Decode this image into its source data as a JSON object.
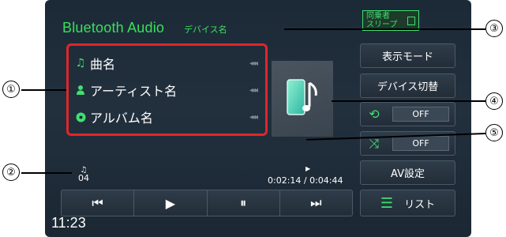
{
  "header": {
    "title": "Bluetooth Audio",
    "device_name": "デバイス名",
    "passenger_label_1": "同乗者",
    "passenger_label_2": "スリープ"
  },
  "track_info": {
    "title": "曲名",
    "artist": "アーティスト名",
    "album": "アルバム名"
  },
  "side_buttons": {
    "display_mode": "表示モード",
    "device_switch": "デバイス切替",
    "repeat_value": "OFF",
    "shuffle_value": "OFF",
    "av_settings": "AV設定",
    "list": "リスト"
  },
  "playback": {
    "track_number": "04",
    "time": "0:02:14 / 0:04:44"
  },
  "transport": {
    "prev": "⏮",
    "play": "▶",
    "pause": "⏸",
    "next": "⏭"
  },
  "clock": "11:23",
  "callouts": [
    "①",
    "②",
    "③",
    "④",
    "⑤"
  ],
  "colors": {
    "accent_green": "#38e05b",
    "highlight_red": "#e0262a",
    "screen_bg": "#1f2c39"
  }
}
